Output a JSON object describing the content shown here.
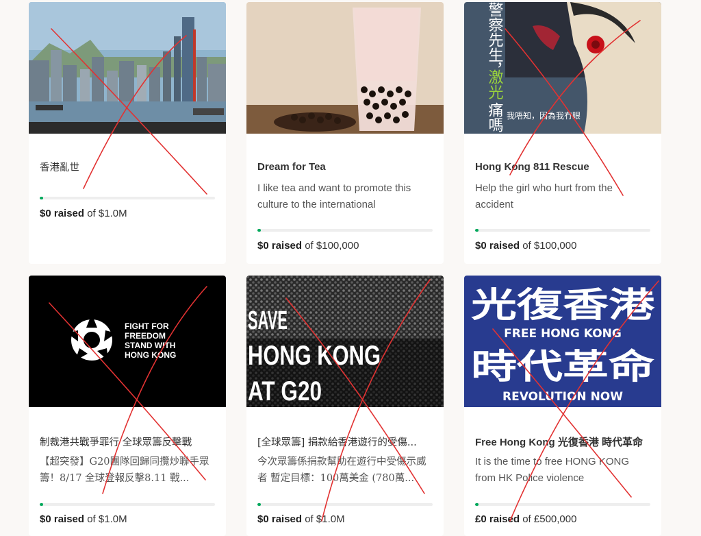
{
  "campaigns": [
    {
      "title": "香港亂世",
      "description": "",
      "progress": 0.02,
      "raised_amount": "$0 raised",
      "goal": "of $1.0M"
    },
    {
      "title": "Dream for Tea",
      "description": "I like tea and want to promote this culture to the international",
      "progress": 0.02,
      "raised_amount": "$0 raised",
      "goal": "of $100,000"
    },
    {
      "title": "Hong Kong 811 Rescue",
      "description": "Help the girl who hurt from the accident",
      "progress": 0.02,
      "raised_amount": "$0 raised",
      "goal": "of $100,000",
      "image_text": {
        "left": "警察先生，",
        "highlight": "激光",
        "left2": "痛嗎",
        "right": "我唔知，因為我冇眼"
      }
    },
    {
      "title": "制裁港共戰爭罪行 全球眾籌反擊戰",
      "description": "【超突發】G20團隊回歸同攬炒聯手眾籌！8/17 全球登報反擊8.11 戰...",
      "progress": 0.02,
      "raised_amount": "$0 raised",
      "goal": "of $1.0M",
      "image_text": [
        "FIGHT FOR",
        "FREEDOM",
        "STAND WITH",
        "HONG KONG"
      ]
    },
    {
      "title": "[全球眾籌] 捐款給香港遊行的受傷...",
      "description": "今次眾籌係捐款幫助在遊行中受傷示威者 暫定目標：100萬美金 (780萬...",
      "progress": 0.02,
      "raised_amount": "$0 raised",
      "goal": "of $1.0M",
      "image_text": [
        "SAVE",
        "HONG KONG",
        "AT G20"
      ]
    },
    {
      "title": "Free Hong Kong 光復香港 時代革命",
      "description": "It is the time to free HONG KONG from HK Police violence",
      "progress": 0.02,
      "raised_amount": "£0 raised",
      "goal": "of £500,000",
      "image_text": [
        "光復香港",
        "FREE HONG KONG",
        "時代革命",
        "REVOLUTION NOW"
      ]
    }
  ],
  "colors": {
    "progress_fill": "#02a95c",
    "progress_track": "#eeeeee",
    "annotation_red": "#e23232"
  }
}
